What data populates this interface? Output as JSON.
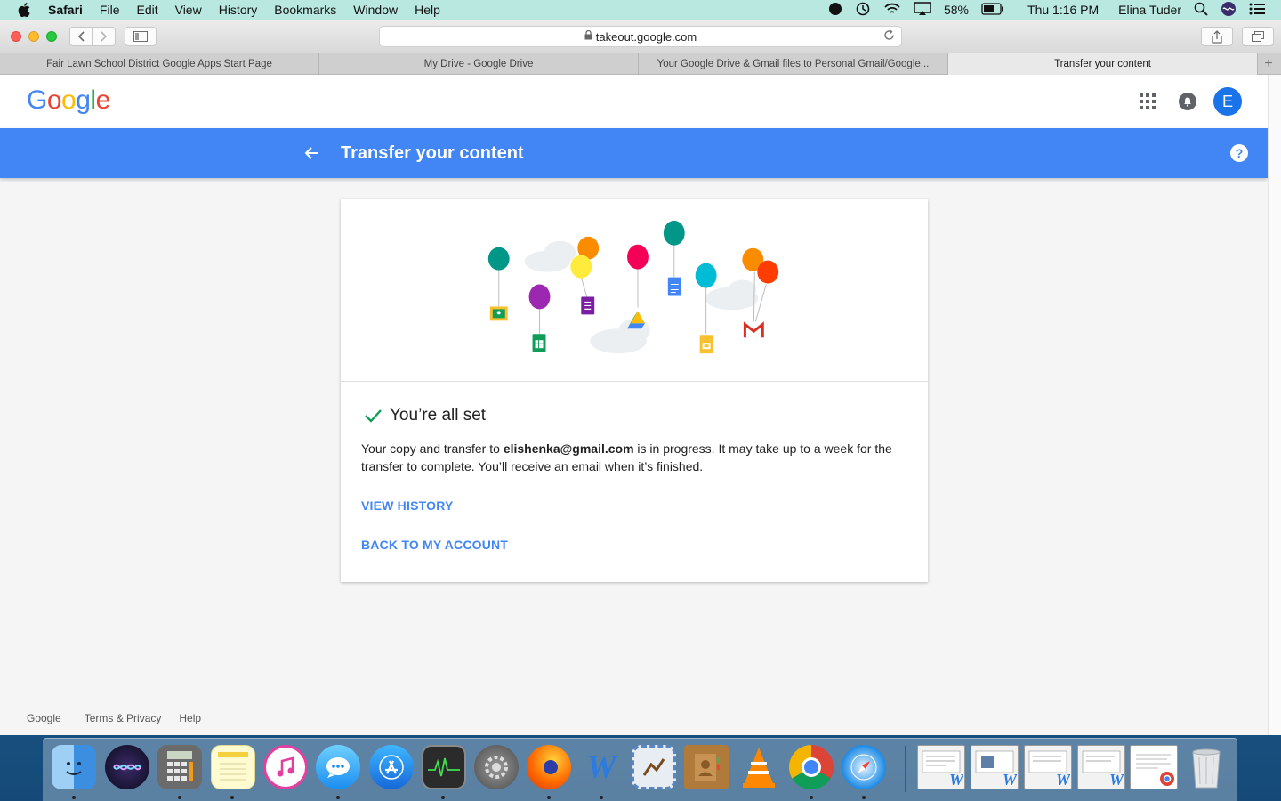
{
  "menubar": {
    "app": "Safari",
    "items": [
      "File",
      "Edit",
      "View",
      "History",
      "Bookmarks",
      "Window",
      "Help"
    ],
    "battery": "58%",
    "clock": "Thu 1:16 PM",
    "user": "Elina Tuder"
  },
  "browser": {
    "url": "takeout.google.com",
    "tabs": [
      {
        "label": "Fair Lawn School District Google Apps Start Page",
        "active": false
      },
      {
        "label": "My Drive - Google Drive",
        "active": false
      },
      {
        "label": "Your Google Drive & Gmail files to Personal Gmail/Google...",
        "active": false
      },
      {
        "label": "Transfer your content",
        "active": true
      }
    ],
    "new_tab": "+"
  },
  "header": {
    "logo": "Google",
    "avatar_letter": "E"
  },
  "titlebar": {
    "title": "Transfer your content",
    "help": "?"
  },
  "card": {
    "heading": "You’re all set",
    "message_prefix": "Your copy and transfer to ",
    "email": "elishenka@gmail.com",
    "message_suffix": " is in progress. It may take up to a week for the transfer to complete. You’ll receive an email when it’s finished.",
    "view_history": "VIEW HISTORY",
    "back_account": "BACK TO MY ACCOUNT"
  },
  "footer": {
    "links": [
      "Google",
      "Terms & Privacy",
      "Help"
    ]
  },
  "colors": {
    "accent": "#4285f4",
    "check": "#0f9d58"
  },
  "dock": {
    "apps": [
      "finder-icon",
      "siri-icon",
      "calculator-icon",
      "notes-icon",
      "itunes-icon",
      "messages-icon",
      "app-store-icon",
      "activity-monitor-icon",
      "system-preferences-icon",
      "firefox-icon",
      "word-icon",
      "preview-icon",
      "contacts-icon",
      "vlc-icon",
      "chrome-icon",
      "safari-icon"
    ],
    "minimized": [
      "word-doc-window-1",
      "word-doc-window-2",
      "word-doc-window-3",
      "word-doc-window-4",
      "chrome-window"
    ],
    "trash": "trash-icon"
  }
}
